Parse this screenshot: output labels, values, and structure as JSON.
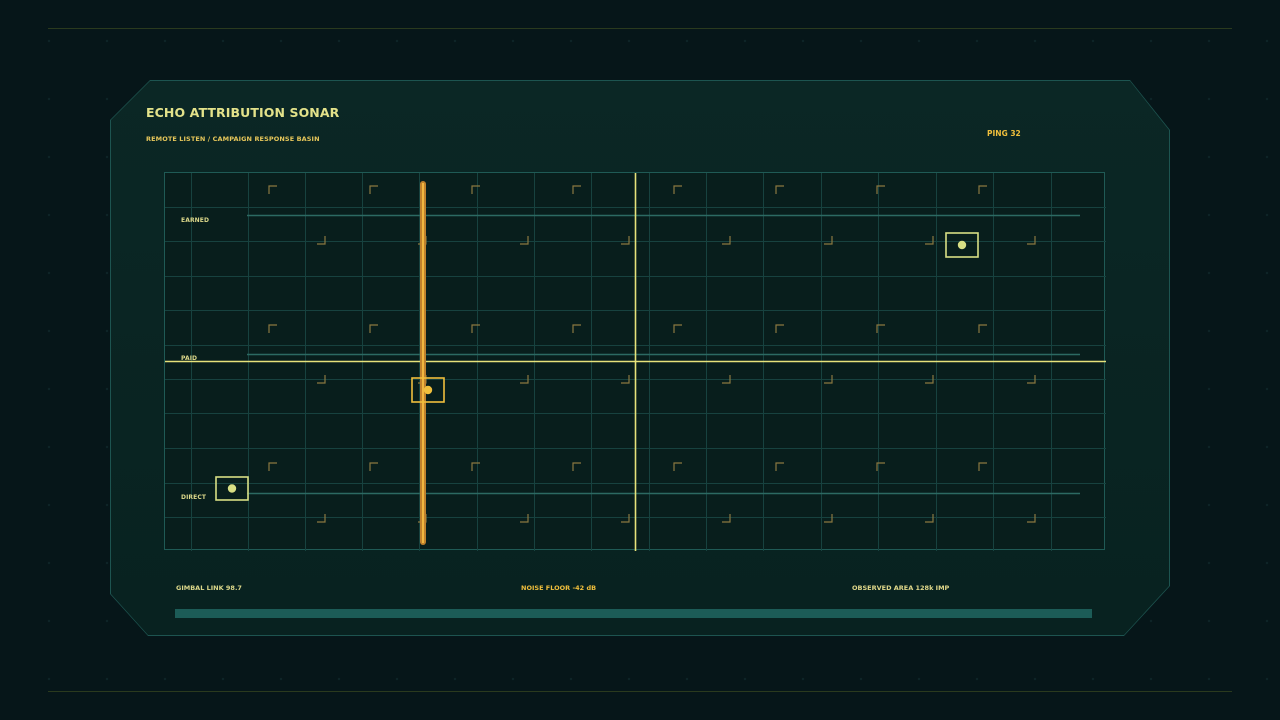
{
  "panel": {
    "title": "ECHO ATTRIBUTION SONAR",
    "subtitle": "REMOTE LISTEN / CAMPAIGN RESPONSE BASIN",
    "ping": "PING 32"
  },
  "lanes": [
    {
      "label": "EARNED"
    },
    {
      "label": "PAID"
    },
    {
      "label": "DIRECT"
    }
  ],
  "targets": [
    {
      "lane": "EARNED",
      "state": "locked"
    },
    {
      "lane": "PAID",
      "state": "active"
    },
    {
      "lane": "DIRECT",
      "state": "locked"
    }
  ],
  "footer": {
    "gimbal": "GIMBAL LINK 98.7",
    "noise": "NOISE FLOOR -42 dB",
    "observed": "OBSERVED AREA 128k IMP"
  },
  "colors": {
    "accent": "#e3e28a",
    "amber": "#f0bf3c",
    "gimbal_text": "#dcd88a",
    "grid": "#1f5a55",
    "crosshair": "#e6e27a"
  }
}
